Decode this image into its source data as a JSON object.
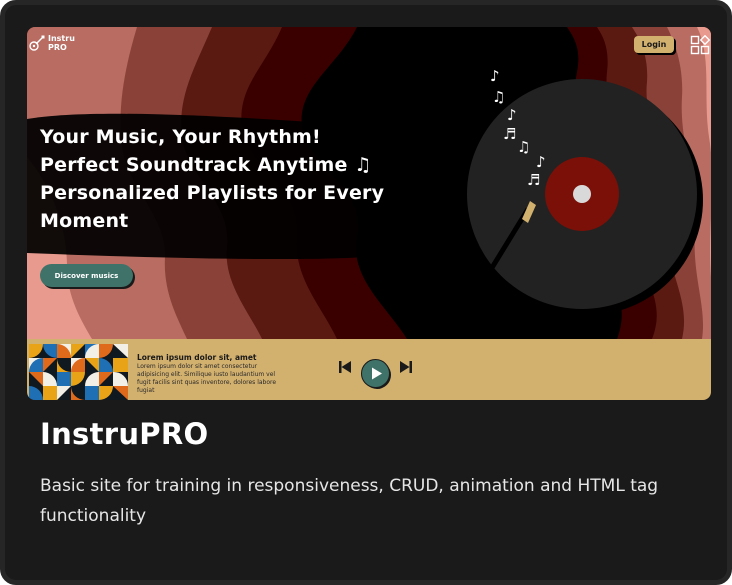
{
  "card": {
    "title": "InstruPRO",
    "description": "Basic site for training in responsiveness, CRUD, animation and HTML tag functionality"
  },
  "site": {
    "logo": {
      "line1": "Instru",
      "line2": "PRO",
      "icon": "guitar-icon"
    },
    "login_label": "Login",
    "menu_icon": "grid-shapes-icon",
    "headline": [
      "Your Music, Your Rhythm!",
      "Perfect Soundtrack Anytime ♫",
      "Personalized Playlists for Every",
      "Moment"
    ],
    "cta_label": "Discover musics",
    "player": {
      "track_title": "Lorem ipsum dolor sit, amet",
      "track_description": "Lorem ipsum dolor sit amet consectetur adipisicing elit. Similique iusto laudantium vel fugit facilis sint quas inventore, dolores labore fugiat",
      "controls": [
        "skip-previous-icon",
        "play-icon",
        "skip-next-icon"
      ]
    },
    "notes": [
      "♪",
      "♫",
      "♪",
      "♬",
      "♫",
      "♪",
      "♬"
    ]
  },
  "colors": {
    "card_bg": "#1a1a1a",
    "gold": "#d2b06e",
    "teal": "#3f7268",
    "record_label": "#7a1008",
    "wave_dark": "#3a0000",
    "wave_light": "#e89a8e"
  }
}
